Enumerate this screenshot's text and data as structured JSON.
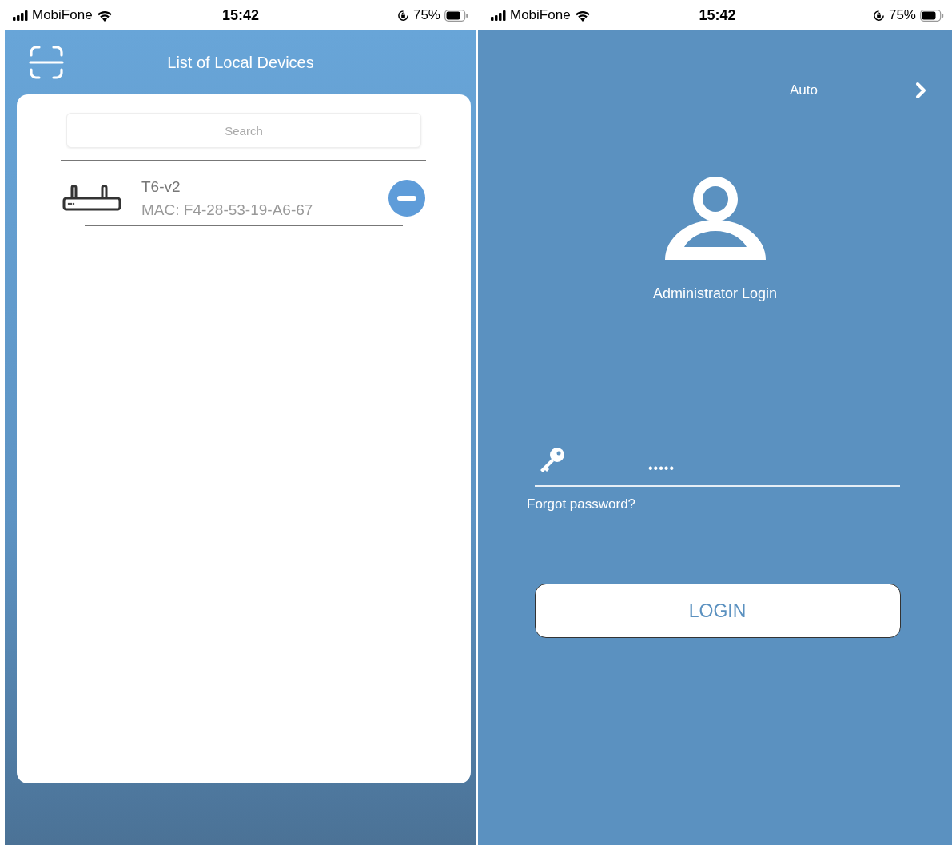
{
  "screens": [
    {
      "kind": "devices",
      "status_bar": {
        "carrier": "MobiFone",
        "time": "15:42",
        "battery": "75%"
      },
      "header": {
        "title": "List of Local Devices"
      },
      "search": {
        "placeholder": "Search"
      },
      "devices": [
        {
          "name": "T6-v2",
          "mac": "MAC: F4-28-53-19-A6-67"
        }
      ]
    },
    {
      "kind": "login",
      "status_bar": {
        "carrier": "MobiFone",
        "time": "15:42",
        "battery": "75%"
      },
      "mode": {
        "label": "Auto"
      },
      "title": "Administrator Login",
      "password": {
        "value": "•••••"
      },
      "forgot_link": "Forgot password?",
      "login_button": "LOGIN"
    }
  ]
}
